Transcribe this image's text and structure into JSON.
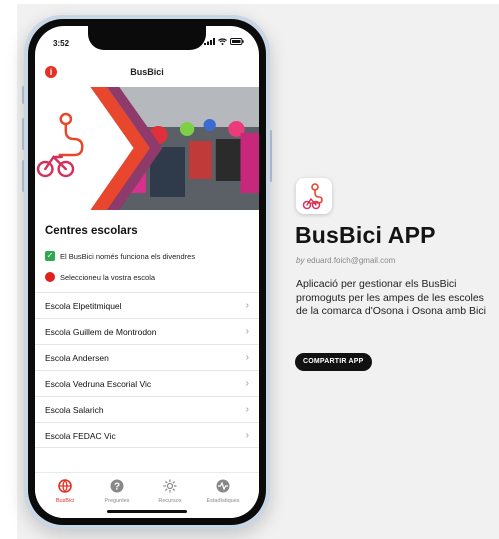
{
  "status": {
    "time": "3:52"
  },
  "appbar": {
    "title": "BusBici",
    "info_icon": "info-icon"
  },
  "content": {
    "section_title": "Centres escolars",
    "notes": [
      {
        "icon": "check-icon",
        "text": "El BusBici només funciona els divendres"
      },
      {
        "icon": "red-dot-icon",
        "text": "Seleccioneu la vostra escola"
      }
    ],
    "schools": [
      "Escola Elpetitmiquel",
      "Escola Guillem de Montrodon",
      "Escola Andersen",
      "Escola Vedruna Escorial Vic",
      "Escola Salarich",
      "Escola FEDAC Vic"
    ]
  },
  "tabs": [
    {
      "label": "BusBici",
      "icon": "globe-icon",
      "active": true
    },
    {
      "label": "Preguntes",
      "icon": "question-icon",
      "active": false
    },
    {
      "label": "Recursos",
      "icon": "sun-icon",
      "active": false
    },
    {
      "label": "Estadístiques",
      "icon": "pulse-icon",
      "active": false
    }
  ],
  "info": {
    "app_name": "BusBici APP",
    "author_prefix": "by",
    "author_email": "eduard.foich@gmail.com",
    "description": "Aplicació per gestionar els BusBici promoguts per les ampes de les escoles de la comarca d'Osona i Osona amb Bici",
    "share_label": "COMPARTIR APP"
  },
  "colors": {
    "accent": "#e53025",
    "check": "#2fa84f",
    "dark": "#111111"
  }
}
